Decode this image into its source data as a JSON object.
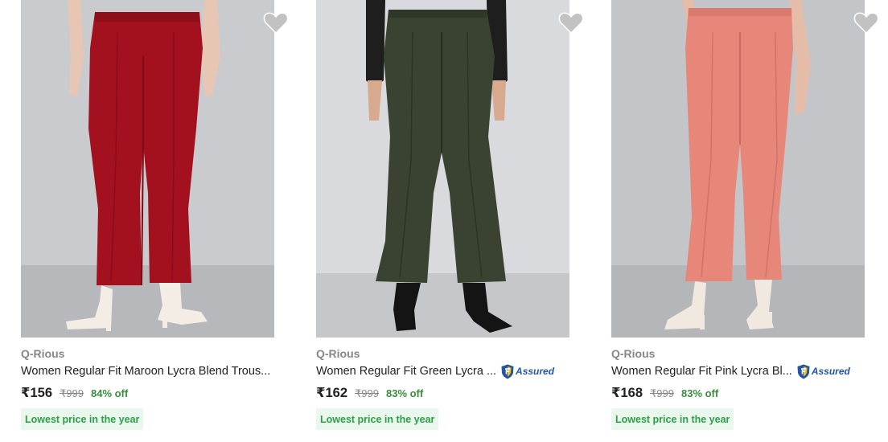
{
  "products": [
    {
      "brand": "Q-Rious",
      "title": "Women Regular Fit Maroon Lycra Blend Trous...",
      "assured": false,
      "assured_label": "",
      "price": "₹156",
      "mrp": "₹999",
      "discount": "84% off",
      "badge": "Lowest price in the year",
      "image_icon": "maroon-trousers-photo",
      "colors": {
        "pant": "#a3111f",
        "pant_shade": "#7e0c17",
        "background": "#c9cbcf",
        "floor": "#b7b8bc"
      }
    },
    {
      "brand": "Q-Rious",
      "title": "Women Regular Fit Green Lycra ...",
      "assured": true,
      "assured_label": "Assured",
      "price": "₹162",
      "mrp": "₹999",
      "discount": "83% off",
      "badge": "Lowest price in the year",
      "image_icon": "green-trousers-photo",
      "colors": {
        "pant": "#3a4332",
        "pant_shade": "#262c21",
        "background": "#d9dadd",
        "floor": "#c6c7ca"
      }
    },
    {
      "brand": "Q-Rious",
      "title": "Women Regular Fit Pink Lycra Bl...",
      "assured": true,
      "assured_label": "Assured",
      "price": "₹168",
      "mrp": "₹999",
      "discount": "83% off",
      "badge": "Lowest price in the year",
      "image_icon": "pink-trousers-photo",
      "colors": {
        "pant": "#e7877a",
        "pant_shade": "#c86b60",
        "background": "#c3c5c9",
        "floor": "#b5b6ba"
      }
    }
  ],
  "theme": {
    "brand_gray": "#878787",
    "text_dark": "#212121",
    "discount_green": "#388e3c",
    "badge_bg": "#e9f7ec",
    "badge_text": "#2e9e4a",
    "assured_blue": "#2455a4",
    "wishlist_gray": "#c2c2c2"
  }
}
